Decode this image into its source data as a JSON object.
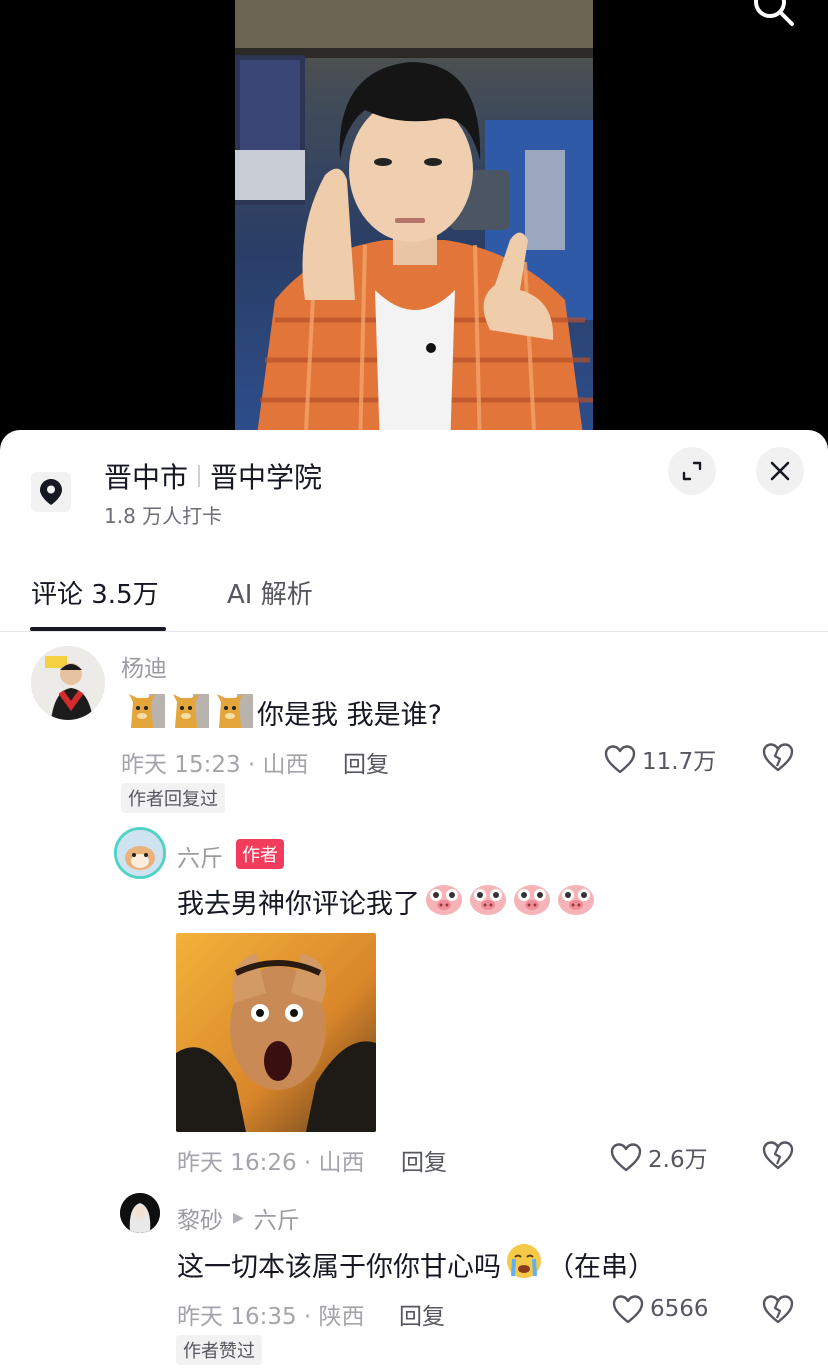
{
  "location": {
    "city": "晋中市",
    "place": "晋中学院",
    "checkins": "1.8 万人打卡"
  },
  "tabs": {
    "comments": "评论 3.5万",
    "ai": "AI 解析"
  },
  "comments": [
    {
      "user": "杨迪",
      "text": "你是我 我是谁?",
      "time_loc": "昨天 15:23 · 山西",
      "reply": "回复",
      "likes": "11.7万",
      "tag": "作者回复过"
    },
    {
      "user": "六斤",
      "badge": "作者",
      "text": "我去男神你评论我了",
      "time_loc": "昨天 16:26 · 山西",
      "reply": "回复",
      "likes": "2.6万"
    },
    {
      "user": "黎砂",
      "reply_to": "六斤",
      "text": "这一切本该属于你你甘心吗",
      "text_suffix": "（在串）",
      "time_loc": "昨天 16:35 · 陕西",
      "reply": "回复",
      "likes": "6566",
      "tag": "作者赞过"
    }
  ],
  "icons": {
    "search": "search-icon",
    "location": "location-pin-icon",
    "expand": "expand-icon",
    "close": "close-icon",
    "like": "heart-icon",
    "dislike": "broken-heart-icon"
  },
  "colors": {
    "author_badge": "#f23c5b",
    "text_primary": "#161823",
    "text_secondary": "#9b9ca3"
  }
}
